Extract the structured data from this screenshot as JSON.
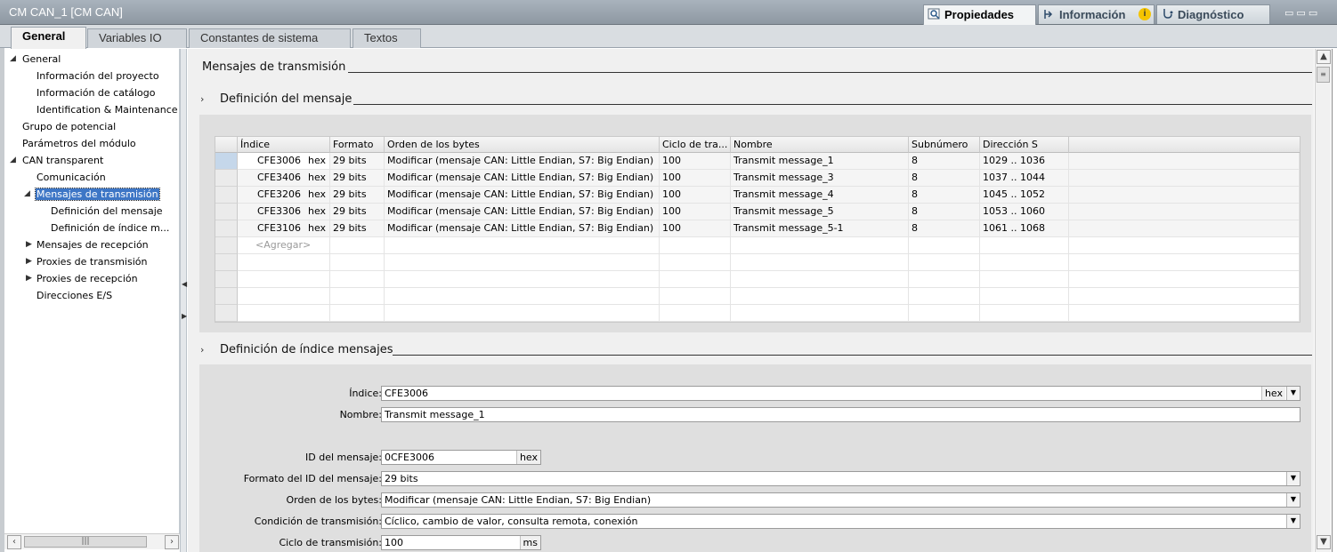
{
  "window": {
    "title": "CM CAN_1 [CM CAN]"
  },
  "inspector_tabs": [
    {
      "label": "Propiedades",
      "icon": "properties-icon",
      "active": true
    },
    {
      "label": "Información",
      "icon": "info-icon",
      "badge": "i"
    },
    {
      "label": "Diagnóstico",
      "icon": "diagnostics-icon"
    }
  ],
  "tabs": [
    {
      "label": "General",
      "active": true
    },
    {
      "label": "Variables IO"
    },
    {
      "label": "Constantes de sistema"
    },
    {
      "label": "Textos"
    }
  ],
  "tree": [
    {
      "label": "General",
      "expanded": true,
      "level": 0
    },
    {
      "label": "Información del proyecto",
      "level": 1
    },
    {
      "label": "Información de catálogo",
      "level": 1
    },
    {
      "label": "Identification & Maintenance",
      "level": 1
    },
    {
      "label": "Grupo de potencial",
      "level": 0
    },
    {
      "label": "Parámetros del módulo",
      "level": 0
    },
    {
      "label": "CAN transparent",
      "expanded": true,
      "level": 0
    },
    {
      "label": "Comunicación",
      "level": 1
    },
    {
      "label": "Mensajes de transmisión",
      "expanded": true,
      "level": 1,
      "selected": true
    },
    {
      "label": "Definición del mensaje",
      "level": 2
    },
    {
      "label": "Definición de índice m...",
      "level": 2
    },
    {
      "label": "Mensajes de recepción",
      "collapsed": true,
      "level": 1
    },
    {
      "label": "Proxies de transmisión",
      "collapsed": true,
      "level": 1
    },
    {
      "label": "Proxies de recepción",
      "collapsed": true,
      "level": 1
    },
    {
      "label": "Direcciones E/S",
      "level": 1
    }
  ],
  "main": {
    "heading": "Mensajes de transmisión",
    "section1": "Definición del mensaje",
    "section2": "Definición de índice mensajes",
    "table": {
      "columns": [
        "Índice",
        "Formato",
        "Orden de los bytes",
        "Ciclo de tra...",
        "Nombre",
        "Subnúmero",
        "Dirección S"
      ],
      "rows": [
        {
          "indice": "CFE3006",
          "radix": "hex",
          "formato": "29 bits",
          "orden": "Modificar (mensaje CAN: Little Endian, S7: Big Endian)",
          "ciclo": "100",
          "nombre": "Transmit message_1",
          "sub": "8",
          "dir": "1029 .. 1036"
        },
        {
          "indice": "CFE3406",
          "radix": "hex",
          "formato": "29 bits",
          "orden": "Modificar (mensaje CAN: Little Endian, S7: Big Endian)",
          "ciclo": "100",
          "nombre": "Transmit message_3",
          "sub": "8",
          "dir": "1037 .. 1044"
        },
        {
          "indice": "CFE3206",
          "radix": "hex",
          "formato": "29 bits",
          "orden": "Modificar (mensaje CAN: Little Endian, S7: Big Endian)",
          "ciclo": "100",
          "nombre": "Transmit message_4",
          "sub": "8",
          "dir": "1045 .. 1052"
        },
        {
          "indice": "CFE3306",
          "radix": "hex",
          "formato": "29 bits",
          "orden": "Modificar (mensaje CAN: Little Endian, S7: Big Endian)",
          "ciclo": "100",
          "nombre": "Transmit message_5",
          "sub": "8",
          "dir": "1053 .. 1060"
        },
        {
          "indice": "CFE3106",
          "radix": "hex",
          "formato": "29 bits",
          "orden": "Modificar (mensaje CAN: Little Endian, S7: Big Endian)",
          "ciclo": "100",
          "nombre": "Transmit message_5-1",
          "sub": "8",
          "dir": "1061 .. 1068"
        }
      ],
      "add_row": "<Agregar>"
    },
    "form": {
      "indice_label": "Índice:",
      "indice_value": "CFE3006",
      "indice_suffix": "hex",
      "nombre_label": "Nombre:",
      "nombre_value": "Transmit message_1",
      "id_label": "ID del mensaje:",
      "id_value": "0CFE3006",
      "id_suffix": "hex",
      "formato_label": "Formato del ID del mensaje:",
      "formato_value": "29 bits",
      "orden_label": "Orden de los bytes:",
      "orden_value": "Modificar (mensaje CAN: Little Endian, S7: Big Endian)",
      "condicion_label": "Condición de transmisión:",
      "condicion_value": "Cíclico, cambio de valor, consulta remota, conexión",
      "ciclo_label": "Ciclo de transmisión:",
      "ciclo_value": "100",
      "ciclo_suffix": "ms"
    }
  }
}
